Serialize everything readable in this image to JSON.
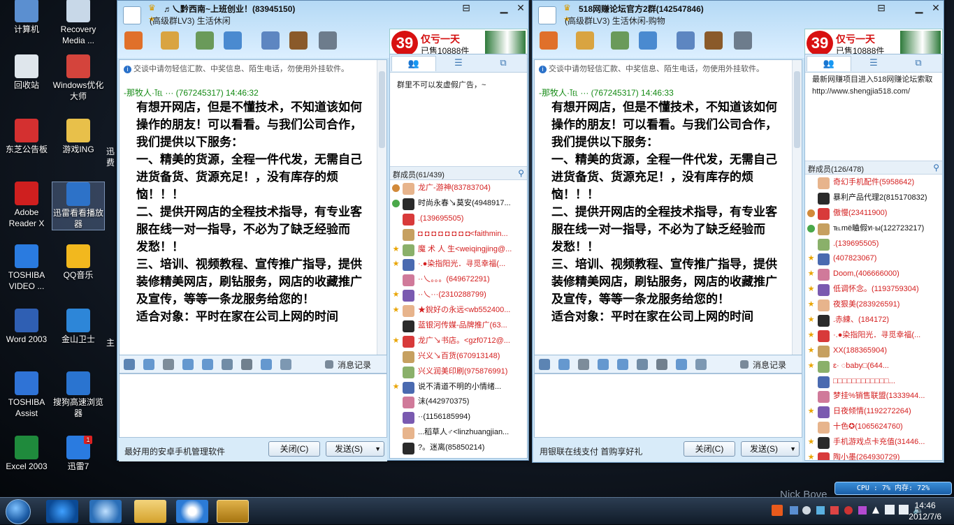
{
  "desktop": {
    "icons": [
      {
        "label": "计算机",
        "color": "#5b8fd0"
      },
      {
        "label": "Recovery Media ...",
        "color": "#c8d8e8"
      },
      {
        "label": "回收站",
        "color": "#dfe6ec"
      },
      {
        "label": "Windows优化大师",
        "color": "#d4443c"
      },
      {
        "label": "东芝公告板",
        "color": "#d43030"
      },
      {
        "label": "游戏ING",
        "color": "#e8c04a"
      },
      {
        "label": "Adobe Reader X",
        "color": "#cf1f1f"
      },
      {
        "label": "迅雷看看播放器",
        "color": "#2d72c8"
      },
      {
        "label": "TOSHIBA VIDEO ...",
        "color": "#2a7be0"
      },
      {
        "label": "QQ音乐",
        "color": "#f2b81e"
      },
      {
        "label": "Word 2003",
        "color": "#2f5fb3"
      },
      {
        "label": "金山卫士",
        "color": "#2d86d8"
      },
      {
        "label": "TOSHIBA Assist",
        "color": "#2f73d6"
      },
      {
        "label": "搜狗高速浏览器",
        "color": "#2a74d0"
      },
      {
        "label": "Excel 2003",
        "color": "#1f8a3c"
      },
      {
        "label": "迅雷7",
        "color": "#2a7be0",
        "badge": "1"
      },
      {
        "label": "迅",
        "color": ""
      },
      {
        "label": "费",
        "color": ""
      },
      {
        "label": "主",
        "color": ""
      }
    ],
    "nick": "Nick Bove"
  },
  "windows": [
    {
      "title": "♬乀黔西南~上班创业！(83945150)",
      "subtitle": "(高级群LV3) 生活休闲",
      "ad": {
        "num": "39",
        "line1": "仅亏一天",
        "line2": "已售10888件"
      },
      "notice": "交谈中请勿轻信汇款、中奖信息、陌生电话，勿使用外挂软件。",
      "sender": "-那牧人·℡ ··· (767245317)  14:46:32",
      "message": "有想开网店，但是不懂技术，不知道该如何操作的朋友！可以看看。与我们公司合作，我们提供以下服务：\n一、精美的货源，全程一件代发，无需自己进货备货、货源充足！，没有库存的烦恼！！！\n二、提供开网店的全程技术指导，有专业客服在线一对一指导，不必为了缺乏经验而\n发愁！！\n三、培训、视频教程、宣传推广指导，提供装修精美网店，刷钻服务，网店的收藏推广及宣传，等等一条龙服务给您的！\n适合对象：平时在家在公司上网的时间",
      "history": "消息记录",
      "bottom_text": "最好用的安卓手机管理软件",
      "close_btn": "关闭(C)",
      "send_btn": "发送(S)",
      "announcement": "群里不可以发虚假广告，~",
      "members_header": "群成员(61/439)",
      "members": [
        {
          "name": "龙广-游神(83783704)",
          "color": "#d42020",
          "badge": "person"
        },
        {
          "name": "时尚永春↘莫安(4948917...",
          "color": "#111",
          "badge": "person2"
        },
        {
          "name": ".(139695505)",
          "color": "#d42020",
          "badge": ""
        },
        {
          "name": "◘ ◘ ◘ ◘ ◘ ◘ ◘ ◘<faithmin...",
          "color": "#d42020",
          "badge": ""
        },
        {
          "name": "魔 术 人 生<weiqingjing@...",
          "color": "#d42020",
          "badge": "star"
        },
        {
          "name": "·.●染指阳光．寻觅幸福(...",
          "color": "#d42020",
          "badge": "star"
        },
        {
          "name": "··乀。。。(649672291)",
          "color": "#d42020",
          "badge": ""
        },
        {
          "name": "··乀···(2310288799)",
          "color": "#d42020",
          "badge": "star"
        },
        {
          "name": "★銳好の永远<wb552400...",
          "color": "#d42020",
          "badge": "star"
        },
        {
          "name": "蓝银河传媒-品牌推广(63...",
          "color": "#d42020",
          "badge": ""
        },
        {
          "name": "龙广↘书店。<gzf0712@...",
          "color": "#d42020",
          "badge": "star"
        },
        {
          "name": "兴义↘百货(670913148)",
          "color": "#d42020",
          "badge": ""
        },
        {
          "name": "兴义润美印刷(975876991)",
          "color": "#d42020",
          "badge": ""
        },
        {
          "name": "说不清道不明的小情绪...",
          "color": "#111",
          "badge": "star"
        },
        {
          "name": "沫(442970375)",
          "color": "#111",
          "badge": ""
        },
        {
          "name": "··(1156185994)",
          "color": "#111",
          "badge": ""
        },
        {
          "name": "...稻草人♂<linzhuangjian...",
          "color": "#111",
          "badge": ""
        },
        {
          "name": "?。迷离(85850214)",
          "color": "#111",
          "badge": ""
        }
      ]
    },
    {
      "title": "518网赚论坛官方2群(142547846)",
      "subtitle": "(高级群LV3) 生活休闲-购物",
      "ad": {
        "num": "39",
        "line1": "仅亏一天",
        "line2": "已售10888件"
      },
      "notice": "交谈中请勿轻信汇款、中奖信息、陌生电话，勿使用外挂软件。",
      "sender": "-那牧人·℡ ··· (767245317)  14:46:33",
      "message": "有想开网店，但是不懂技术，不知道该如何操作的朋友！可以看看。与我们公司合作，我们提供以下服务：\n一、精美的货源，全程一件代发，无需自己进货备货、货源充足！，没有库存的烦恼！！！\n二、提供开网店的全程技术指导，有专业客服在线一对一指导，不必为了缺乏经验而\n发愁！！\n三、培训、视频教程、宣传推广指导，提供装修精美网店，刷钻服务，网店的收藏推广及宣传，等等一条龙服务给您的！\n适合对象：平时在家在公司上网的时间",
      "history": "消息记录",
      "bottom_text": "用银联在线支付 首购享好礼",
      "close_btn": "关闭(C)",
      "send_btn": "发送(S)",
      "announcement": "最新网赚项目进入518网赚论坛索取\nhttp://www.shengjia518.com/",
      "members_header": "群成员(126/478)",
      "members": [
        {
          "name": "奇幻手机配件(5958642)",
          "color": "#d42020",
          "badge": ""
        },
        {
          "name": "暴利产品代理2(815170832)",
          "color": "#111",
          "badge": ""
        },
        {
          "name": "傲慢(23411900)",
          "color": "#d42020",
          "badge": "person"
        },
        {
          "name": "℡mё瞌假ท·ы(122723217)",
          "color": "#111",
          "badge": "person2"
        },
        {
          "name": ".(139695505)",
          "color": "#d42020",
          "badge": ""
        },
        {
          "name": "(407823067)",
          "color": "#d42020",
          "badge": "star"
        },
        {
          "name": "Doom,(406666000)",
          "color": "#d42020",
          "badge": "star"
        },
        {
          "name": "低调怀念。(1193759304)",
          "color": "#d42020",
          "badge": "star"
        },
        {
          "name": "夜狠美(283926591)",
          "color": "#d42020",
          "badge": "star"
        },
        {
          "name": ".赤練、(184172)",
          "color": "#d42020",
          "badge": "star"
        },
        {
          "name": "·.●染指阳光．寻觅幸福(...",
          "color": "#d42020",
          "badge": "star"
        },
        {
          "name": "XX(188365904)",
          "color": "#d42020",
          "badge": "star"
        },
        {
          "name": "ɛ·    ◌baby□(644...",
          "color": "#d42020",
          "badge": "star"
        },
        {
          "name": "□□□□□□□□□□□□...",
          "color": "#d42020",
          "badge": ""
        },
        {
          "name": "梦挂%销售联盟(1333944...",
          "color": "#d42020",
          "badge": ""
        },
        {
          "name": "日夜倾情(1192272264)",
          "color": "#d42020",
          "badge": "star"
        },
        {
          "name": "十色✪(1065624760)",
          "color": "#d42020",
          "badge": ""
        },
        {
          "name": "手机游戏点卡充值(31446...",
          "color": "#d42020",
          "badge": "star"
        },
        {
          "name": "陶小墨(264930729)",
          "color": "#d42020",
          "badge": "star"
        }
      ]
    }
  ],
  "tray": {
    "cpu": "CPU : 7%   内存: 72%",
    "time": "14:46",
    "date": "2012/7/6"
  }
}
